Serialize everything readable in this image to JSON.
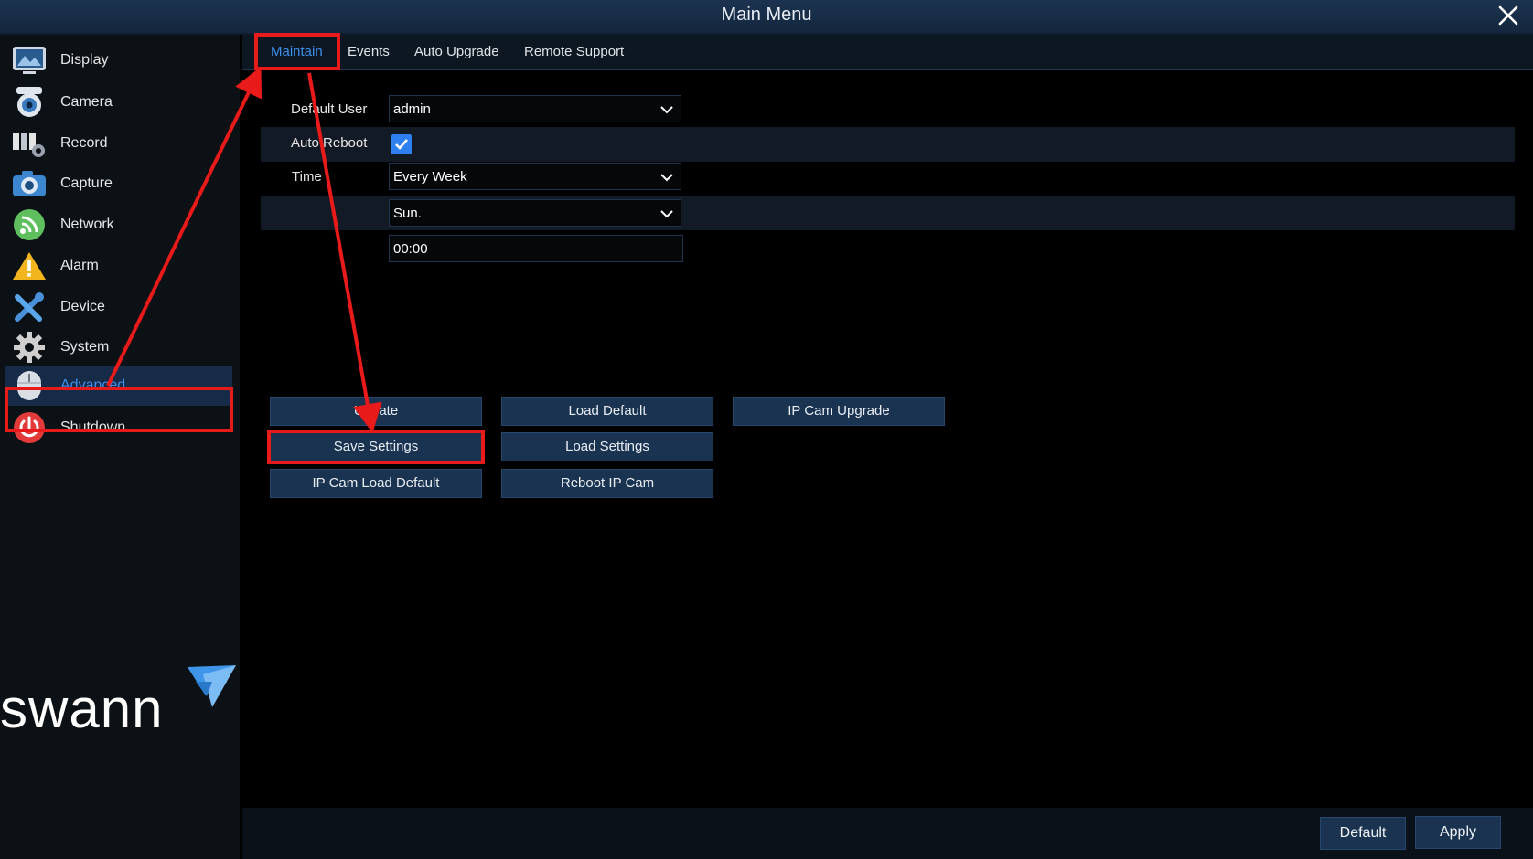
{
  "window": {
    "title": "Main Menu",
    "close_icon": "close-icon"
  },
  "sidebar": {
    "items": [
      {
        "label": "Display",
        "icon": "display-icon"
      },
      {
        "label": "Camera",
        "icon": "camera-icon"
      },
      {
        "label": "Record",
        "icon": "record-icon"
      },
      {
        "label": "Capture",
        "icon": "capture-icon"
      },
      {
        "label": "Network",
        "icon": "network-icon"
      },
      {
        "label": "Alarm",
        "icon": "alarm-icon"
      },
      {
        "label": "Device",
        "icon": "device-icon"
      },
      {
        "label": "System",
        "icon": "system-icon"
      },
      {
        "label": "Advanced",
        "icon": "advanced-icon",
        "active": true
      },
      {
        "label": "Shutdown",
        "icon": "shutdown-icon"
      }
    ],
    "logo_text": "swann"
  },
  "tabs": [
    {
      "label": "Maintain",
      "active": true
    },
    {
      "label": "Events"
    },
    {
      "label": "Auto Upgrade"
    },
    {
      "label": "Remote Support"
    }
  ],
  "form": {
    "default_user": {
      "label": "Default User",
      "value": "admin"
    },
    "auto_reboot": {
      "label": "Auto Reboot",
      "checked": true
    },
    "time": {
      "label": "Time",
      "value": "Every Week"
    },
    "day": {
      "value": "Sun."
    },
    "clock": {
      "value": "00:00"
    }
  },
  "buttons": {
    "update": "Update",
    "load_default": "Load Default",
    "ip_cam_upgrade": "IP Cam Upgrade",
    "save_settings": "Save Settings",
    "load_settings": "Load Settings",
    "ip_cam_load_default": "IP Cam Load Default",
    "reboot_ip_cam": "Reboot IP Cam"
  },
  "footer": {
    "default": "Default",
    "apply": "Apply"
  },
  "colors": {
    "accent": "#3d8ff0",
    "highlight": "#e81a1a",
    "button": "#1a3350",
    "titlebar": "#1c3350"
  }
}
